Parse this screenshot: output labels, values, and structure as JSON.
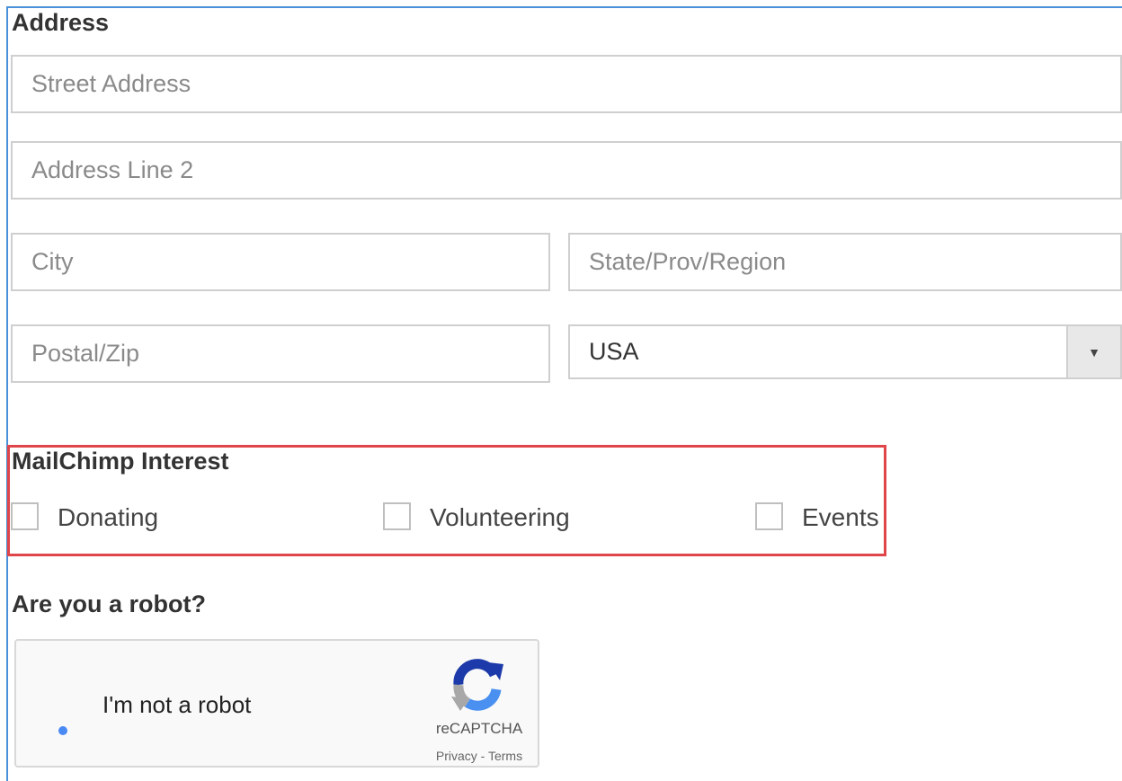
{
  "address": {
    "heading": "Address",
    "street_placeholder": "Street Address",
    "line2_placeholder": "Address Line 2",
    "city_placeholder": "City",
    "state_placeholder": "State/Prov/Region",
    "postal_placeholder": "Postal/Zip",
    "country_value": "USA"
  },
  "mailchimp": {
    "heading": "MailChimp Interest",
    "options": [
      {
        "label": "Donating",
        "checked": false
      },
      {
        "label": "Volunteering",
        "checked": false
      },
      {
        "label": "Events",
        "checked": false
      }
    ],
    "highlight_color": "#e0454a"
  },
  "robot": {
    "heading": "Are you a robot?",
    "checkbox_label": "I'm not a robot",
    "brand": "reCAPTCHA",
    "links": "Privacy - Terms"
  },
  "icons": {
    "dropdown": "chevron-down-icon",
    "captcha_logo": "recaptcha-logo-icon"
  }
}
